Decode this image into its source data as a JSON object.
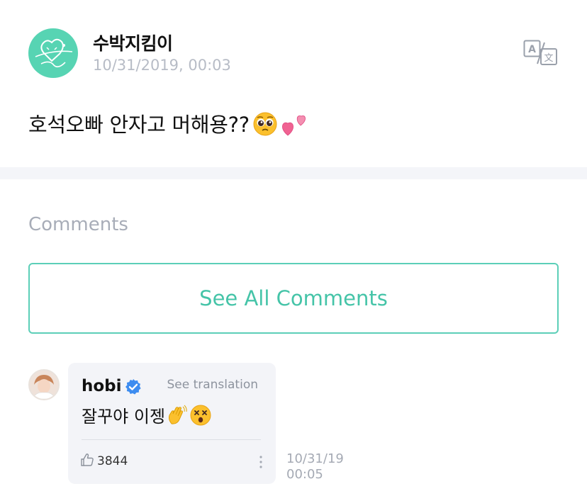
{
  "post": {
    "author": "수박지킴이",
    "timestamp": "10/31/2019, 00:03",
    "text": "호석오빠 안자고 머해용??",
    "emojis": [
      "pleading-face",
      "two-hearts"
    ]
  },
  "comments_section": {
    "label": "Comments",
    "see_all_label": "See All Comments"
  },
  "comment": {
    "author": "hobi",
    "verified": true,
    "see_translation": "See translation",
    "text": "잘꾸야 이젱",
    "emojis": [
      "waving-hand",
      "dizzy-face"
    ],
    "likes": "3844",
    "date": "10/31/19",
    "time": "00:05"
  },
  "colors": {
    "accent": "#45c4a8",
    "avatar_bg": "#57d4b3",
    "muted": "#b7bcc6",
    "bubble_bg": "#f3f4f8",
    "verified": "#3d8cf0"
  }
}
